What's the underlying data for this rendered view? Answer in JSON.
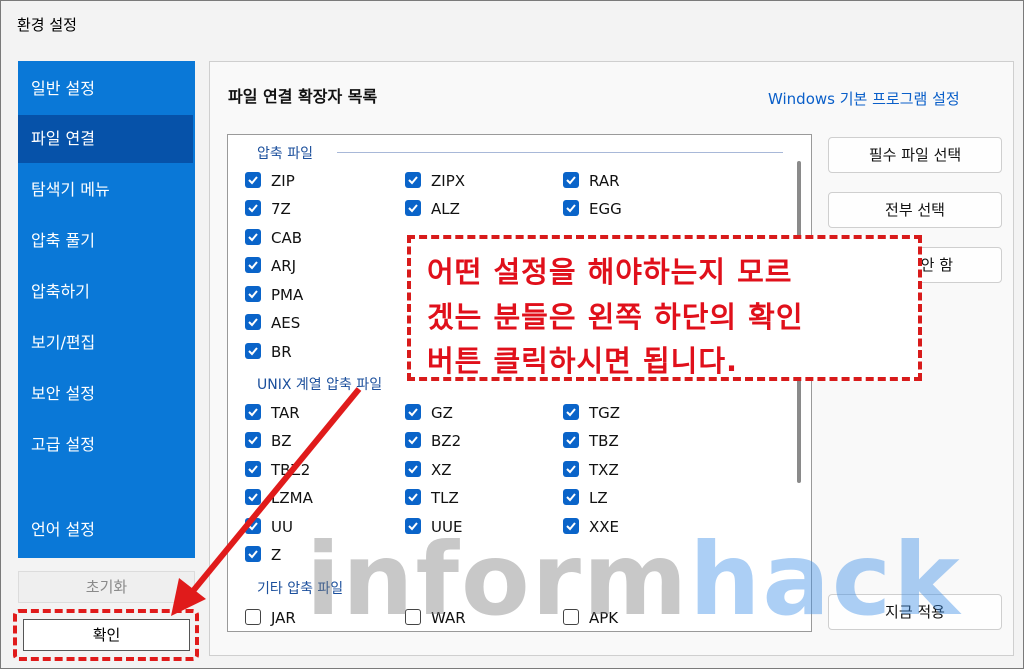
{
  "window": {
    "title": "환경 설정"
  },
  "sidebar": {
    "items": [
      {
        "label": "일반 설정",
        "active": false
      },
      {
        "label": "파일 연결",
        "active": true
      },
      {
        "label": "탐색기 메뉴",
        "active": false
      },
      {
        "label": "압축 풀기",
        "active": false
      },
      {
        "label": "압축하기",
        "active": false
      },
      {
        "label": "보기/편집",
        "active": false
      },
      {
        "label": "보안 설정",
        "active": false
      },
      {
        "label": "고급 설정",
        "active": false
      },
      {
        "label": "언어 설정",
        "active": false
      }
    ]
  },
  "footer": {
    "reset_label": "초기화",
    "ok_label": "확인"
  },
  "main": {
    "title": "파일 연결 확장자 목록",
    "windows_link": "Windows 기본 프로그램 설정"
  },
  "groups": [
    {
      "label": "압축 파일"
    },
    {
      "label": "UNIX 계열 압축 파일"
    },
    {
      "label": "기타 압축 파일"
    }
  ],
  "extensions": {
    "archive": [
      {
        "label": "ZIP",
        "checked": true
      },
      {
        "label": "ZIPX",
        "checked": true
      },
      {
        "label": "RAR",
        "checked": true
      },
      {
        "label": "7Z",
        "checked": true
      },
      {
        "label": "ALZ",
        "checked": true
      },
      {
        "label": "EGG",
        "checked": true
      },
      {
        "label": "CAB",
        "checked": true
      },
      {
        "label": "ARJ",
        "checked": true
      },
      {
        "label": "PMA",
        "checked": true
      },
      {
        "label": "AES",
        "checked": true
      },
      {
        "label": "BR",
        "checked": true
      }
    ],
    "unix": [
      {
        "label": "TAR",
        "checked": true
      },
      {
        "label": "GZ",
        "checked": true
      },
      {
        "label": "TGZ",
        "checked": true
      },
      {
        "label": "BZ",
        "checked": true
      },
      {
        "label": "BZ2",
        "checked": true
      },
      {
        "label": "TBZ",
        "checked": true
      },
      {
        "label": "TBZ2",
        "checked": true
      },
      {
        "label": "XZ",
        "checked": true
      },
      {
        "label": "TXZ",
        "checked": true
      },
      {
        "label": "LZMA",
        "checked": true
      },
      {
        "label": "TLZ",
        "checked": true
      },
      {
        "label": "LZ",
        "checked": true
      },
      {
        "label": "UU",
        "checked": true
      },
      {
        "label": "UUE",
        "checked": true
      },
      {
        "label": "XXE",
        "checked": true
      },
      {
        "label": "Z",
        "checked": true
      }
    ],
    "other": [
      {
        "label": "JAR",
        "checked": false
      },
      {
        "label": "WAR",
        "checked": false
      },
      {
        "label": "APK",
        "checked": false
      }
    ]
  },
  "right_buttons": {
    "required": "필수 파일 선택",
    "select_all": "전부 선택",
    "deselect_all_partial": "안 함",
    "apply_now": "지금 적용"
  },
  "annotation": {
    "lines": [
      "어떤 설정을 해야하는지 모르",
      "겠는 분들은 왼쪽 하단의 확인",
      "버튼 클릭하시면 됩니다."
    ]
  },
  "watermark": {
    "part1": "inform",
    "part2": "hack"
  },
  "colors": {
    "accent": "#0a78d7",
    "active_item": "#0652a9",
    "annotation_red": "#e0101b"
  }
}
